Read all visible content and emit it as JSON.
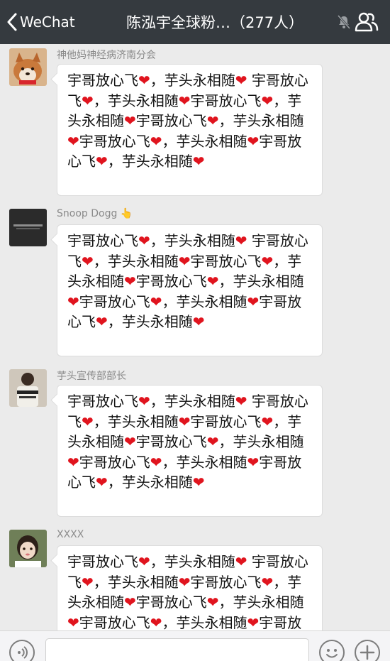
{
  "navbar": {
    "back_label": "WeChat",
    "title": "陈泓宇全球粉…（277人）",
    "back_icon": "chevron-left-icon",
    "mute_icon": "bell-muted-icon",
    "members_icon": "group-members-icon"
  },
  "messages": [
    {
      "sender": "神他妈神经病济南分会",
      "text": "宇哥放心飞❤️，芋头永相随❤️ 宇哥放心飞❤️，芋头永相随❤️宇哥放心飞❤️，芋头永相随❤️宇哥放心飞❤️，芋头永相随❤️宇哥放心飞❤️，芋头永相随❤️宇哥放心飞❤️，芋头永相随❤️"
    },
    {
      "sender": "Snoop Dogg 👆",
      "text": "宇哥放心飞❤️，芋头永相随❤️ 宇哥放心飞❤️，芋头永相随❤️宇哥放心飞❤️，芋头永相随❤️宇哥放心飞❤️，芋头永相随❤️宇哥放心飞❤️，芋头永相随❤️宇哥放心飞❤️，芋头永相随❤️"
    },
    {
      "sender": "芋头宣传部部长",
      "text": "宇哥放心飞❤️，芋头永相随❤️ 宇哥放心飞❤️，芋头永相随❤️宇哥放心飞❤️，芋头永相随❤️宇哥放心飞❤️，芋头永相随❤️宇哥放心飞❤️，芋头永相随❤️宇哥放心飞❤️，芋头永相随❤️"
    },
    {
      "sender": "XXXX",
      "text": "宇哥放心飞❤️，芋头永相随❤️ 宇哥放心飞❤️，芋头永相随❤️宇哥放心飞❤️，芋头永相随❤️宇哥放心飞❤️，芋头永相随❤️宇哥放心飞❤️，芋头永相随❤️宇哥放心飞❤️，芋头永相随❤️"
    }
  ],
  "inputbar": {
    "voice_icon": "voice-icon",
    "emoji_icon": "emoji-icon",
    "plus_icon": "plus-icon",
    "placeholder": ""
  },
  "colors": {
    "navbar_bg": "#353a3f",
    "chat_bg": "#ebebeb",
    "bubble_bg": "#ffffff",
    "heart": "#e0141e",
    "sender_text": "#8a8a8a"
  }
}
